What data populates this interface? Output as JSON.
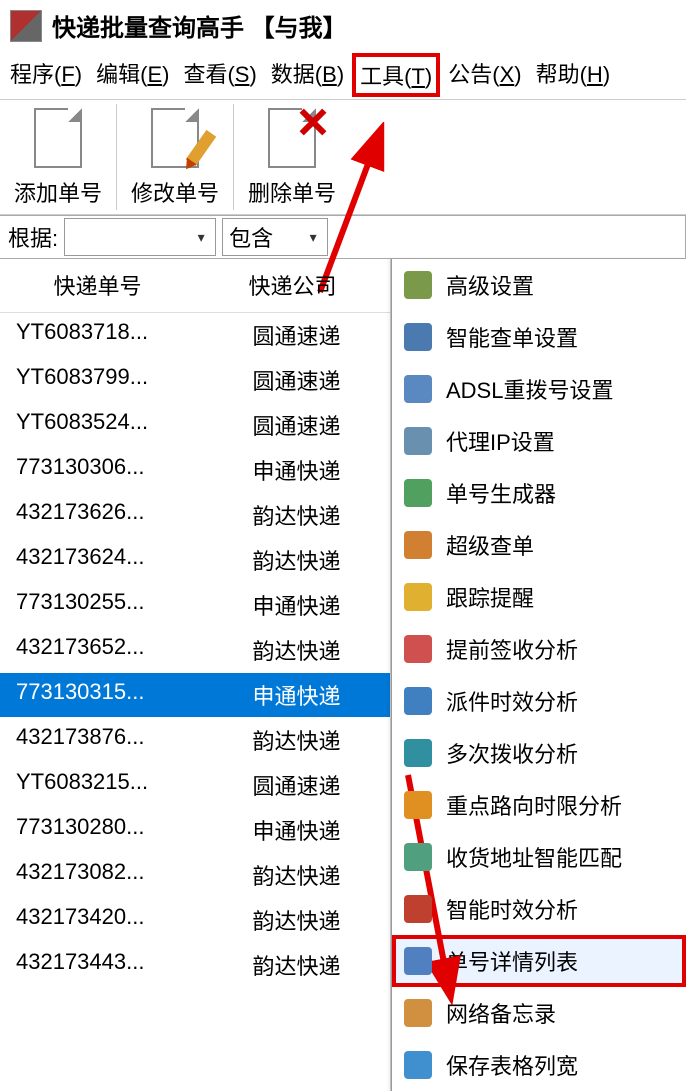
{
  "titlebar": {
    "title": "快递批量查询高手  【与我】"
  },
  "menubar": {
    "items": [
      {
        "label": "程序",
        "key": "F"
      },
      {
        "label": "编辑",
        "key": "E"
      },
      {
        "label": "查看",
        "key": "S"
      },
      {
        "label": "数据",
        "key": "B"
      },
      {
        "label": "工具",
        "key": "T",
        "highlight": true
      },
      {
        "label": "公告",
        "key": "X"
      },
      {
        "label": "帮助",
        "key": "H"
      }
    ]
  },
  "toolbar": {
    "btns": [
      {
        "label": "添加单号"
      },
      {
        "label": "修改单号"
      },
      {
        "label": "删除单号"
      }
    ]
  },
  "filter": {
    "label": "根据:",
    "op": "包含"
  },
  "table": {
    "headers": [
      "快递单号",
      "快递公司"
    ],
    "rows": [
      {
        "no": "YT6083718...",
        "co": "圆通速递"
      },
      {
        "no": "YT6083799...",
        "co": "圆通速递"
      },
      {
        "no": "YT6083524...",
        "co": "圆通速递"
      },
      {
        "no": "773130306...",
        "co": "申通快递"
      },
      {
        "no": "432173626...",
        "co": "韵达快递"
      },
      {
        "no": "432173624...",
        "co": "韵达快递"
      },
      {
        "no": "773130255...",
        "co": "申通快递"
      },
      {
        "no": "432173652...",
        "co": "韵达快递"
      },
      {
        "no": "773130315...",
        "co": "申通快递",
        "selected": true
      },
      {
        "no": "432173876...",
        "co": "韵达快递"
      },
      {
        "no": "YT6083215...",
        "co": "圆通速递"
      },
      {
        "no": "773130280...",
        "co": "申通快递"
      },
      {
        "no": "432173082...",
        "co": "韵达快递"
      },
      {
        "no": "432173420...",
        "co": "韵达快递"
      },
      {
        "no": "432173443...",
        "co": "韵达快递"
      }
    ]
  },
  "toolmenu": {
    "items": [
      {
        "label": "高级设置",
        "color": "#7a9a4a"
      },
      {
        "label": "智能查单设置",
        "color": "#4a7ab0"
      },
      {
        "label": "ADSL重拨号设置",
        "color": "#5a88c0"
      },
      {
        "label": "代理IP设置",
        "color": "#6a90b0"
      },
      {
        "label": "单号生成器",
        "color": "#50a060"
      },
      {
        "label": "超级查单",
        "color": "#d08030"
      },
      {
        "label": "跟踪提醒",
        "color": "#e0b030"
      },
      {
        "label": "提前签收分析",
        "color": "#d05050"
      },
      {
        "label": "派件时效分析",
        "color": "#4080c0"
      },
      {
        "label": "多次拨收分析",
        "color": "#3090a0"
      },
      {
        "label": "重点路向时限分析",
        "color": "#e09020"
      },
      {
        "label": "收货地址智能匹配",
        "color": "#50a080"
      },
      {
        "label": "智能时效分析",
        "color": "#c04030"
      },
      {
        "label": "单号详情列表",
        "color": "#5080c0",
        "highlight": true
      },
      {
        "label": "网络备忘录",
        "color": "#d09040"
      },
      {
        "label": "保存表格列宽",
        "color": "#4090d0"
      }
    ]
  }
}
